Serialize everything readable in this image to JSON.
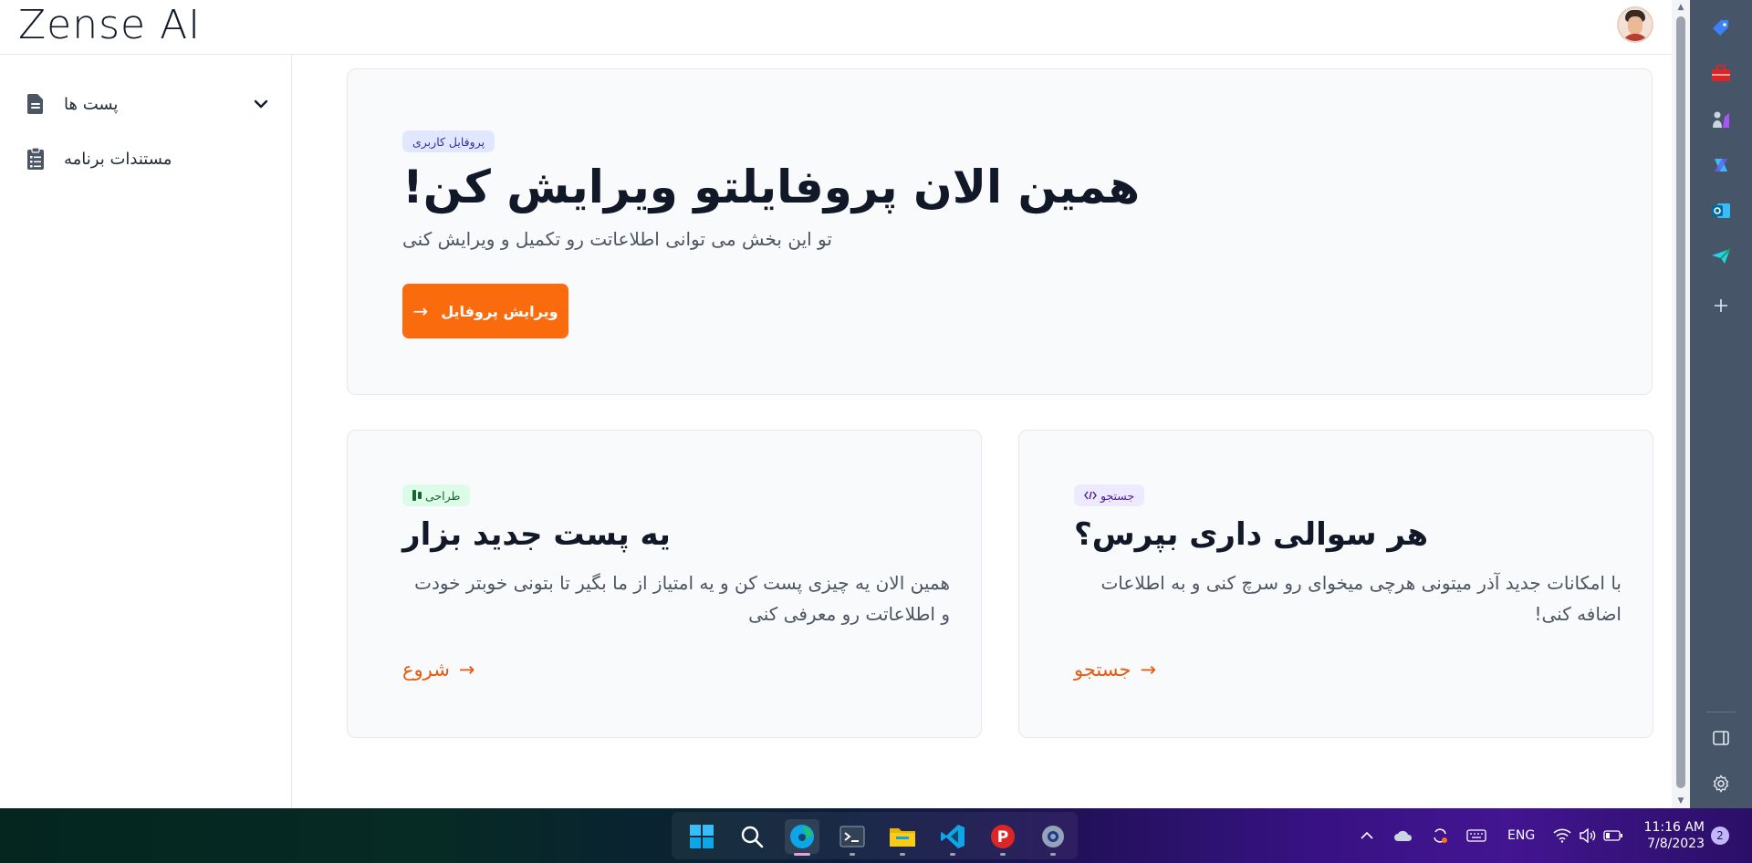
{
  "app": {
    "logo_text": "Zense AI",
    "accent": "#f96b0d"
  },
  "sidebar": {
    "items": [
      {
        "label": "پست ها",
        "icon": "document-icon",
        "expandable": true
      },
      {
        "label": "مستندات برنامه",
        "icon": "clipboard-list-icon",
        "expandable": false
      }
    ]
  },
  "hero": {
    "badge": "پروفایل کاربری",
    "title": "همین الان پروفایلتو ویرایش کن!",
    "subtitle": "تو این بخش می توانی اطلاعاتت رو تکمیل و ویرایش کنی",
    "button_label": "ویرایش پروفایل",
    "button_arrow": "→"
  },
  "cards": [
    {
      "badge": "طراحی",
      "badge_icon": "figma-icon",
      "title": "یه پست جدید بزار",
      "description": "همین الان یه چیزی پست کن و یه امتیاز از ما بگیر تا بتونی خوبتر خودت و اطلاعاتت رو معرفی کنی",
      "link_label": "شروع",
      "link_arrow": "→"
    },
    {
      "badge": "جستجو",
      "badge_icon": "code-icon",
      "title": "هر سوالی داری بپرس؟",
      "description": "با امکانات جدید آذر میتونی هرچی میخوای رو سرچ کنی و به اطلاعات اضافه کنی!",
      "link_label": "جستجو",
      "link_arrow": "→"
    }
  ],
  "edge_sidebar": {
    "icons": [
      "tag-icon",
      "toolbox-icon",
      "chess-icon",
      "copilot-icon",
      "outlook-icon",
      "send-icon",
      "plus-icon",
      "sidebar-toggle-icon",
      "settings-icon"
    ]
  },
  "taskbar": {
    "apps": [
      "windows-start-icon",
      "search-icon",
      "edge-icon",
      "terminal-icon",
      "file-explorer-icon",
      "vscode-icon",
      "psiphon-icon",
      "settings-app-icon"
    ],
    "language": "ENG",
    "time": "11:16 AM",
    "date": "7/8/2023",
    "notifications": "2"
  }
}
